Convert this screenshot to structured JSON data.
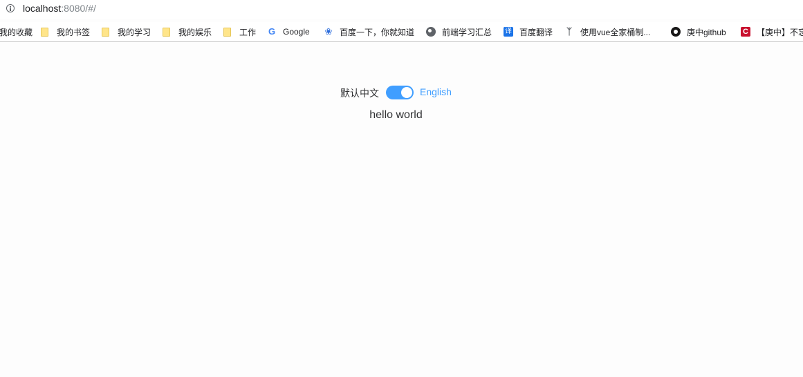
{
  "browser": {
    "url_host": "localhost",
    "url_rest": ":8080/#/"
  },
  "bookmarks": [
    {
      "label": "我的收藏",
      "icon": "folder-icon"
    },
    {
      "label": "我的书签",
      "icon": "folder-icon"
    },
    {
      "label": "我的学习",
      "icon": "folder-icon"
    },
    {
      "label": "我的娱乐",
      "icon": "folder-icon"
    },
    {
      "label": "工作",
      "icon": "folder-icon"
    },
    {
      "label": "Google",
      "icon": "google-icon"
    },
    {
      "label": "百度一下，你就知道",
      "icon": "baidu-paw-icon"
    },
    {
      "label": "前端学习汇总",
      "icon": "globe-icon"
    },
    {
      "label": "百度翻译",
      "icon": "baidu-translate-icon"
    },
    {
      "label": "使用vue全家桶制...",
      "icon": "vue-site-icon"
    },
    {
      "label": "庚中github",
      "icon": "github-icon"
    },
    {
      "label": "【庚中】不忘初心",
      "icon": "csdn-icon"
    }
  ],
  "page": {
    "lang_zh": "默认中文",
    "lang_en": "English",
    "switch_on": true,
    "switch_color": "#409eff",
    "greeting": "hello world"
  }
}
